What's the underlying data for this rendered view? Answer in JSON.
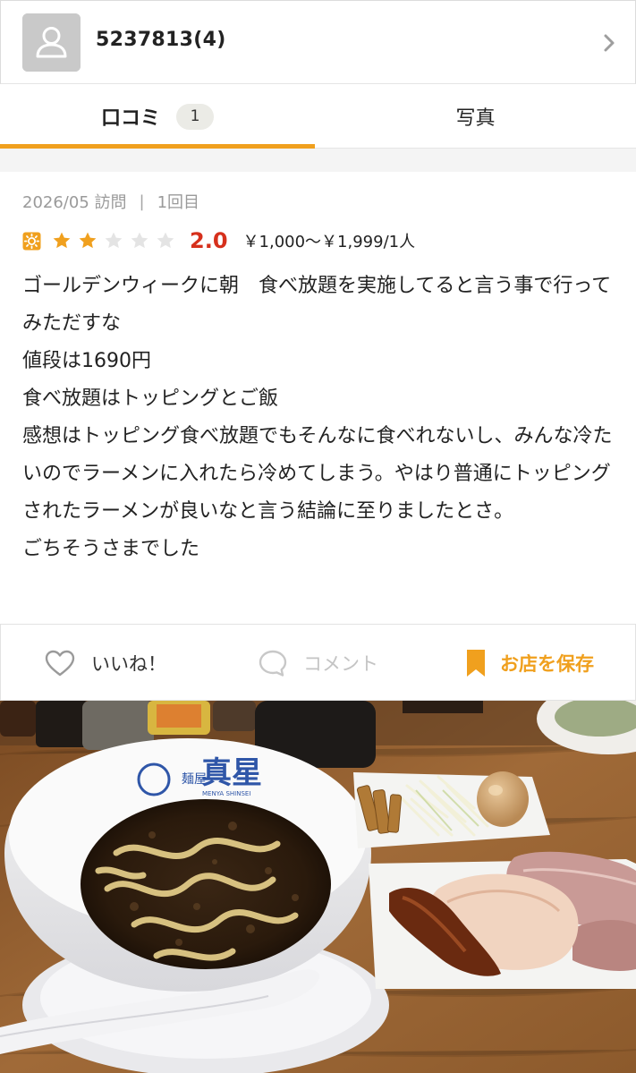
{
  "user": {
    "name": "5237813(4)"
  },
  "tabs": [
    {
      "label": "口コミ",
      "count": "1",
      "active": true
    },
    {
      "label": "写真",
      "active": false
    }
  ],
  "review": {
    "visit_date": "2026/05 訪問",
    "separator": "|",
    "visit_count": "1回目",
    "rating": "2.0",
    "rating_stars_filled": 2,
    "rating_stars_total": 5,
    "price": "￥1,000～￥1,999/1人",
    "body": [
      "ゴールデンウィークに朝　食べ放題を実施してると言う事で行ってみただすな",
      "値段は1690円",
      "食べ放題はトッピングとご飯",
      "感想はトッピング食べ放題でもそんなに食べれないし、みんな冷たいのでラーメンに入れたら冷めてしまう。やはり普通にトッピングされたラーメンが良いなと言う結論に至りましたとさ。",
      "ごちそうさまでした"
    ]
  },
  "actions": {
    "like_label": "いいね！",
    "comment_label": "コメント",
    "save_label": "お店を保存"
  },
  "photo": {
    "bowl_brand_main": "真星",
    "bowl_brand_sub": "麺屋",
    "bowl_brand_roman": "MENYA SHINSEI"
  },
  "colors": {
    "accent": "#f0a01e",
    "rating": "#d6301c",
    "star_filled": "#f0a01e",
    "star_empty": "#e4e4e4"
  }
}
